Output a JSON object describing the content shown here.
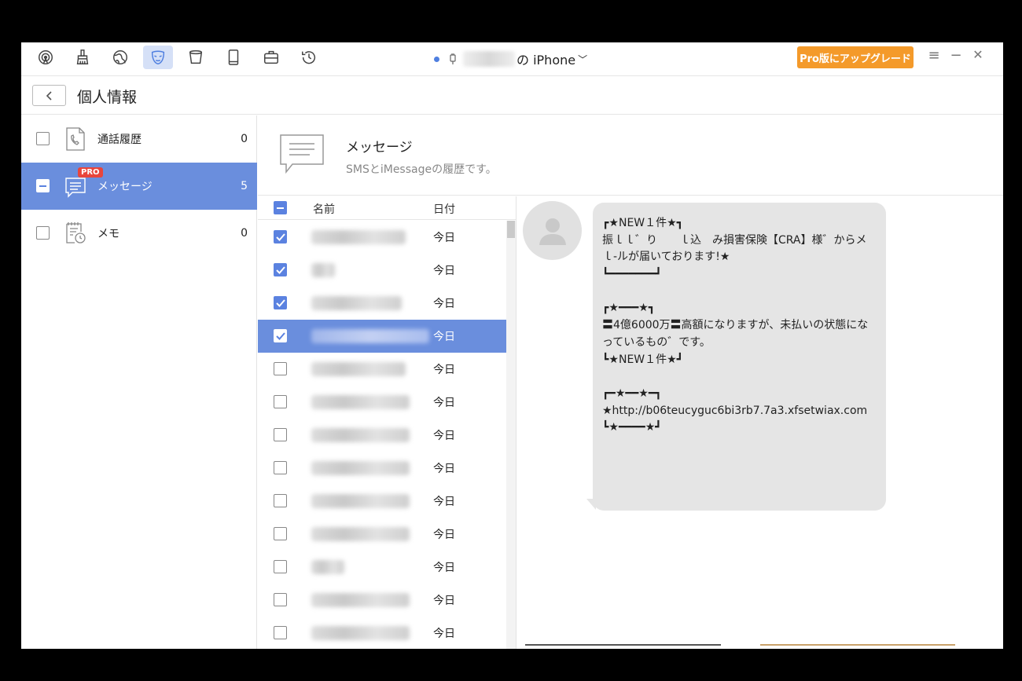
{
  "toolbar": {
    "tools": [
      {
        "icon": "airdrop-icon"
      },
      {
        "icon": "cleaner-icon"
      },
      {
        "icon": "globe-icon"
      },
      {
        "icon": "privacy-mask-icon",
        "active": true
      },
      {
        "icon": "trash-bin-icon"
      },
      {
        "icon": "book-icon"
      },
      {
        "icon": "toolbox-icon"
      },
      {
        "icon": "history-icon"
      }
    ],
    "device_suffix": "の iPhone",
    "device_chevron": "﹀",
    "upgrade_label": "Pro版にアップグレード",
    "menu_glyph": "≡",
    "minimize_glyph": "−",
    "close_glyph": "✕"
  },
  "header": {
    "title": "個人情報"
  },
  "sidebar": {
    "items": [
      {
        "label": "通話履歴",
        "count": "0",
        "icon": "phone-log-icon",
        "selected": false
      },
      {
        "label": "メッセージ",
        "count": "5",
        "icon": "message-icon",
        "selected": true,
        "badge": "PRO"
      },
      {
        "label": "メモ",
        "count": "0",
        "icon": "memo-icon",
        "selected": false
      }
    ]
  },
  "content": {
    "title": "メッセージ",
    "description": "SMSとiMessageの履歴です。"
  },
  "list": {
    "col_name": "名前",
    "col_date": "日付",
    "rows": [
      {
        "date": "今日",
        "checked": true
      },
      {
        "date": "今日",
        "checked": true
      },
      {
        "date": "今日",
        "checked": true
      },
      {
        "date": "今日",
        "checked": true,
        "selected": true
      },
      {
        "date": "今日",
        "checked": false
      },
      {
        "date": "今日",
        "checked": false
      },
      {
        "date": "今日",
        "checked": false
      },
      {
        "date": "今日",
        "checked": false
      },
      {
        "date": "今日",
        "checked": false
      },
      {
        "date": "今日",
        "checked": false
      },
      {
        "date": "今日",
        "checked": false
      },
      {
        "date": "今日",
        "checked": false
      },
      {
        "date": "今日",
        "checked": false
      }
    ]
  },
  "message": {
    "text": "┏★NEW１件★┓\n振ｌｌ゛り　　ｌ込　み損害保険【CRA】様゛からメｌ-ルが届いております!★\n┗━━━━━━━┛\n\n┏★━━━★┓\n〓4億6000万〓高額になりますが、未払いの状態になっているもの゛です。\n┗★NEW１件★┛\n\n┏━★━━★━┓\n★http://b06teucyguc6bi3rb7.7a3.xfsetwiax.com\n┗★━━━━★┛"
  },
  "colors": {
    "accent": "#6a8edd",
    "upgrade": "#f49a2a",
    "pro_badge": "#e8453c",
    "bubble": "#e5e5e5"
  }
}
